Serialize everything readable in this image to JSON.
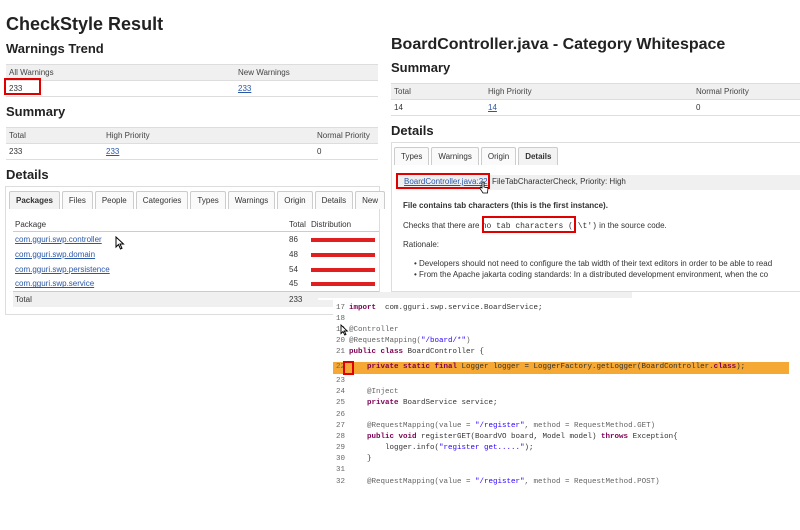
{
  "left": {
    "title": "CheckStyle Result",
    "warnings_trend": {
      "heading": "Warnings Trend",
      "cols": [
        "All Warnings",
        "New Warnings"
      ],
      "values": [
        "233",
        "233"
      ]
    },
    "summary": {
      "heading": "Summary",
      "cols": [
        "Total",
        "High Priority",
        "Normal Priority"
      ],
      "values": [
        "233",
        "233",
        "0"
      ]
    },
    "details": {
      "heading": "Details",
      "tabs": [
        "Packages",
        "Files",
        "People",
        "Categories",
        "Types",
        "Warnings",
        "Origin",
        "Details",
        "New"
      ],
      "cols": [
        "Package",
        "Total",
        "Distribution"
      ],
      "rows": [
        {
          "name": "com.gguri.swp.controller",
          "total": "86",
          "frac": 1.0
        },
        {
          "name": "com.gguri.swp.domain",
          "total": "48",
          "frac": 1.0
        },
        {
          "name": "com.gguri.swp.persistence",
          "total": "54",
          "frac": 1.0
        },
        {
          "name": "com.gguri.swp.service",
          "total": "45",
          "frac": 1.0
        }
      ],
      "total_label": "Total",
      "total_value": "233"
    }
  },
  "right": {
    "title": "BoardController.java - Category Whitespace",
    "summary": {
      "heading": "Summary",
      "cols": [
        "Total",
        "High Priority",
        "Normal Priority"
      ],
      "values": [
        "14",
        "14",
        "0"
      ]
    },
    "details": {
      "heading": "Details",
      "tabs": [
        "Types",
        "Warnings",
        "Origin",
        "Details"
      ],
      "file_link": "BoardController.java:22",
      "file_rest": ", FileTabCharacterCheck, Priority: High",
      "heading_text": "File contains tab characters (this is the first instance).",
      "checks_pre": "Checks that there are",
      "checks_box": "no tab characters ('\\t')",
      "checks_post": "in the source code.",
      "rationale": "Rationale:",
      "bullets": [
        "Developers should not need to configure the tab width of their text editors in order to be able to read",
        "From the Apache jakarta coding standards: In a distributed development environment, when the co"
      ]
    }
  },
  "code": {
    "lines": [
      {
        "n": "17",
        "parts": [
          [
            "kw",
            "import"
          ],
          [
            "",
            "  com.gguri.swp.service.BoardService;"
          ]
        ]
      },
      {
        "n": "18",
        "parts": [
          [
            "",
            ""
          ]
        ]
      },
      {
        "n": "19",
        "parts": [
          [
            "ann",
            "@Controller"
          ]
        ]
      },
      {
        "n": "20",
        "parts": [
          [
            "ann",
            "@RequestMapping("
          ],
          [
            "str",
            "\"/board/*\""
          ],
          [
            "ann",
            ")"
          ]
        ]
      },
      {
        "n": "21",
        "parts": [
          [
            "kw",
            "public class"
          ],
          [
            "",
            " BoardController {"
          ]
        ]
      },
      {
        "n": "22",
        "parts": [
          [
            "",
            ""
          ],
          [
            "kw",
            "    private static final"
          ],
          [
            "",
            " Logger logger = LoggerFactory.getLogger(BoardController."
          ],
          [
            "kw",
            "class"
          ],
          [
            "",
            ");"
          ]
        ]
      },
      {
        "n": "23",
        "parts": [
          [
            "",
            ""
          ]
        ]
      },
      {
        "n": "24",
        "parts": [
          [
            "ann",
            "    @Inject"
          ]
        ]
      },
      {
        "n": "25",
        "parts": [
          [
            "kw",
            "    private"
          ],
          [
            "",
            " BoardService service;"
          ]
        ]
      },
      {
        "n": "26",
        "parts": [
          [
            "",
            ""
          ]
        ]
      },
      {
        "n": "27",
        "parts": [
          [
            "ann",
            "    @RequestMapping(value = "
          ],
          [
            "str",
            "\"/register\""
          ],
          [
            "ann",
            ", method = RequestMethod.GET)"
          ]
        ]
      },
      {
        "n": "28",
        "parts": [
          [
            "kw",
            "    public void"
          ],
          [
            "",
            " registerGET(BoardVO board, Model model) "
          ],
          [
            "kw",
            "throws"
          ],
          [
            "",
            " Exception{"
          ]
        ]
      },
      {
        "n": "29",
        "parts": [
          [
            "",
            "        logger.info("
          ],
          [
            "str",
            "\"register get.....\""
          ],
          [
            "",
            ");"
          ]
        ]
      },
      {
        "n": "30",
        "parts": [
          [
            "",
            "    }"
          ]
        ]
      },
      {
        "n": "31",
        "parts": [
          [
            "",
            ""
          ]
        ]
      },
      {
        "n": "32",
        "parts": [
          [
            "ann",
            "    @RequestMapping(value = "
          ],
          [
            "str",
            "\"/register\""
          ],
          [
            "ann",
            ", method = RequestMethod.POST)"
          ]
        ]
      }
    ]
  },
  "colors": {
    "highlight": "#f5a833",
    "redbox": "#e00000",
    "bar": "#e02020",
    "link": "#2a57a8"
  }
}
